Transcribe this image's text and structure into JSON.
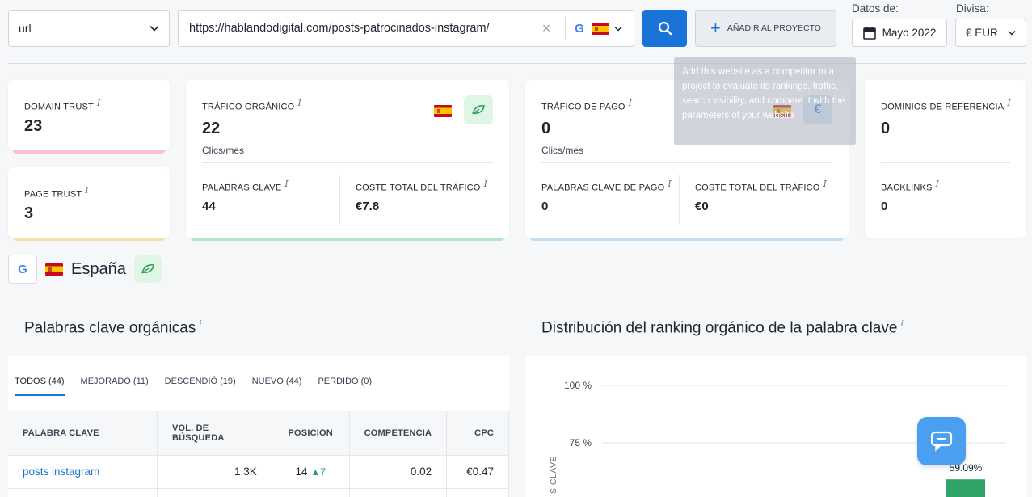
{
  "search": {
    "mode": "url",
    "url": "https://hablandodigital.com/posts-patrocinados-instagram/",
    "add_project_label": "AÑADIR AL PROYECTO",
    "date_label": "Datos de:",
    "date_value": "Mayo 2022",
    "currency_label": "Divisa:",
    "currency_value": "€ EUR"
  },
  "tooltip": "Add this website as a competitor to a project to evaluate its rankings, traffic, search visibility, and compare it with the parameters of your website",
  "metrics": {
    "domain_trust": {
      "label": "DOMAIN TRUST",
      "value": "23"
    },
    "page_trust": {
      "label": "PAGE TRUST",
      "value": "3"
    },
    "organic": {
      "label": "TRÁFICO ORGÁNICO",
      "value": "22",
      "sub": "Clics/mes",
      "kw_label": "PALABRAS CLAVE",
      "kw_value": "44",
      "cost_label": "COSTE TOTAL DEL TRÁFICO",
      "cost_value": "€7.8"
    },
    "paid": {
      "label": "TRÁFICO DE PAGO",
      "value": "0",
      "sub": "Clics/mes",
      "kw_label": "PALABRAS CLAVE DE PAGO",
      "kw_value": "0",
      "cost_label": "COSTE TOTAL DEL TRÁFICO",
      "cost_value": "€0",
      "euro_symbol": "€"
    },
    "refs": {
      "label": "DOMINIOS DE REFERENCIA",
      "value": "0",
      "backlinks_label": "BACKLINKS",
      "backlinks_value": "0"
    }
  },
  "location": {
    "name": "España"
  },
  "keywords_panel": {
    "title": "Palabras clave orgánicas",
    "tabs": [
      "TODOS (44)",
      "MEJORADO (11)",
      "DESCENDIÓ (19)",
      "NUEVO (44)",
      "PERDIDO (0)"
    ],
    "columns": [
      "PALABRA CLAVE",
      "VOL. DE BÚSQUEDA",
      "POSICIÓN",
      "COMPETENCIA",
      "CPC"
    ],
    "rows": [
      {
        "keyword": "posts instagram",
        "volume": "1.3K",
        "position": "14",
        "delta": "▲7",
        "competition": "0.02",
        "cpc": "€0.47"
      }
    ]
  },
  "distribution_panel": {
    "title": "Distribución del ranking orgánico de la palabra clave",
    "y_ticks": [
      "100 %",
      "75 %"
    ],
    "y_axis_partial": "S CLAVE",
    "bar_label": "59.09%"
  },
  "chart_data": {
    "type": "bar",
    "title": "Distribución del ranking orgánico de la palabra clave",
    "ylim": [
      0,
      100
    ],
    "values": [
      59.09
    ],
    "data_labels": [
      "59.09%"
    ]
  }
}
